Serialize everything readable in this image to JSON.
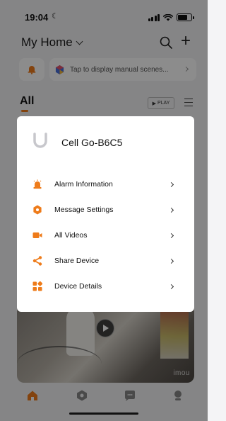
{
  "status_bar": {
    "time": "19:04",
    "moon": "☾"
  },
  "header": {
    "home_title": "My Home"
  },
  "scene_bar": {
    "text": "Tap to display manual scenes..."
  },
  "section": {
    "all_label": "All",
    "play_label": "PLAY"
  },
  "video": {
    "watermark": "imou"
  },
  "modal": {
    "device_name": "Cell Go-B6C5",
    "items": [
      {
        "label": "Alarm Information",
        "icon": "alarm-icon"
      },
      {
        "label": "Message Settings",
        "icon": "message-settings-icon"
      },
      {
        "label": "All Videos",
        "icon": "video-camera-icon"
      },
      {
        "label": "Share Device",
        "icon": "share-icon"
      },
      {
        "label": "Device Details",
        "icon": "device-details-icon"
      }
    ]
  },
  "colors": {
    "accent": "#ee7b1a",
    "overlay": "rgba(0,0,0,0.45)"
  },
  "tab_bar": {
    "tabs": [
      {
        "icon": "home-icon",
        "active": true
      },
      {
        "icon": "scenes-icon",
        "active": false
      },
      {
        "icon": "messages-icon",
        "active": false
      },
      {
        "icon": "profile-icon",
        "active": false
      }
    ]
  }
}
